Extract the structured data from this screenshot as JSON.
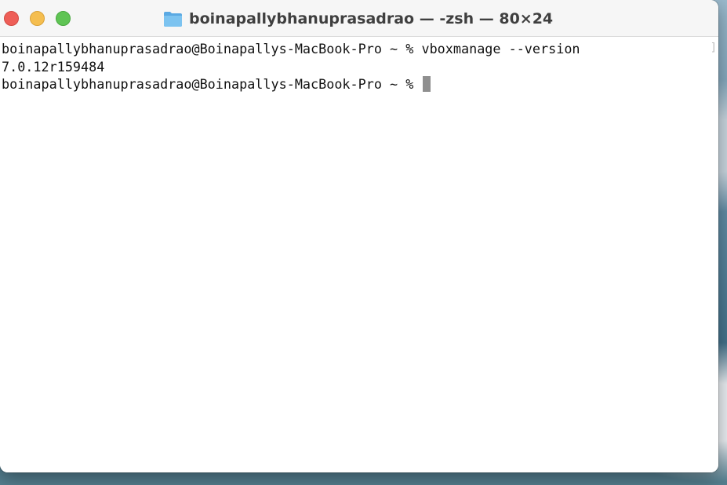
{
  "window": {
    "title": "boinapallybhanuprasadrao — -zsh — 80×24",
    "title_icon": "folder-icon",
    "controls": {
      "close": "close-button",
      "minimize": "minimize-button",
      "zoom": "zoom-button"
    },
    "colors": {
      "close": "#ee5e57",
      "minimize": "#f5be4f",
      "zoom": "#5fc454",
      "folder": "#6cb6ea"
    }
  },
  "terminal": {
    "lines": [
      {
        "prompt": "boinapallybhanuprasadrao@Boinapallys-MacBook-Pro ~ % ",
        "command": "vboxmanage --version"
      },
      {
        "output": "7.0.12r159484"
      },
      {
        "prompt": "boinapallybhanuprasadrao@Boinapallys-MacBook-Pro ~ % ",
        "command": ""
      }
    ],
    "cursor_color": "#8f8f8f"
  }
}
